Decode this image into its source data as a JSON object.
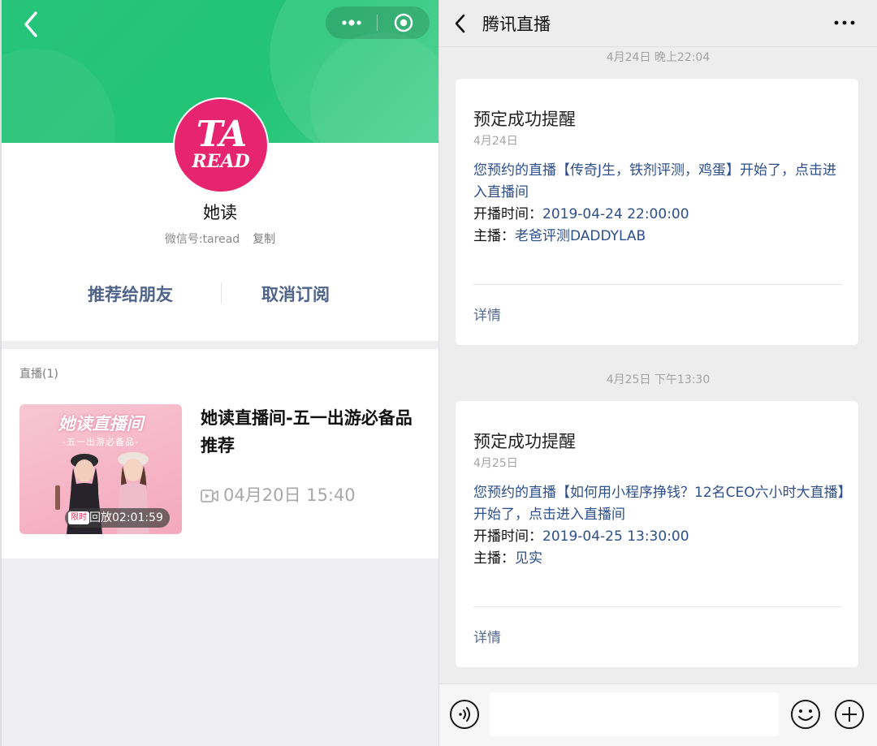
{
  "left": {
    "account_name": "她读",
    "wechat_id": "微信号:taread",
    "copy_label": "复制",
    "logo_text_top": "TA",
    "logo_text_bottom": "READ",
    "actions": {
      "recommend": "推荐给朋友",
      "unsubscribe": "取消订阅"
    },
    "live_section": {
      "heading": "直播(1)",
      "item": {
        "thumbnail_title": "她读直播间",
        "thumbnail_subtitle": "-五一出游必备品-",
        "replay_tag": "限时",
        "replay_label": "回放02:01:59",
        "title": "她读直播间-五一出游必备品推荐",
        "time": "04月20日 15:40"
      }
    },
    "colors": {
      "header_green": "#23c475",
      "avatar_pink": "#e6246f",
      "action_blue": "#4f6488"
    }
  },
  "right": {
    "nav_title": "腾讯直播",
    "messages": [
      {
        "timestamp": "4月24日 晚上22:04",
        "title": "预定成功提醒",
        "date": "4月24日",
        "body": "您预约的直播【传奇J生，铁剂评测，鸡蛋】开始了，点击进入直播间",
        "start_label": "开播时间：",
        "start_time": "2019-04-24 22:00:00",
        "host_label": "主播：",
        "host": "老爸评测DADDYLAB",
        "detail": "详情"
      },
      {
        "timestamp": "4月25日 下午13:30",
        "title": "预定成功提醒",
        "date": "4月25日",
        "body": "您预约的直播【如何用小程序挣钱？12名CEO六小时大直播】开始了，点击进入直播间",
        "start_label": "开播时间：",
        "start_time": "2019-04-25 13:30:00",
        "host_label": "主播：",
        "host": "见实",
        "detail": "详情"
      }
    ],
    "input_placeholder": "",
    "colors": {
      "link_blue": "#576b95",
      "body_blue": "#2d4f8b"
    }
  }
}
